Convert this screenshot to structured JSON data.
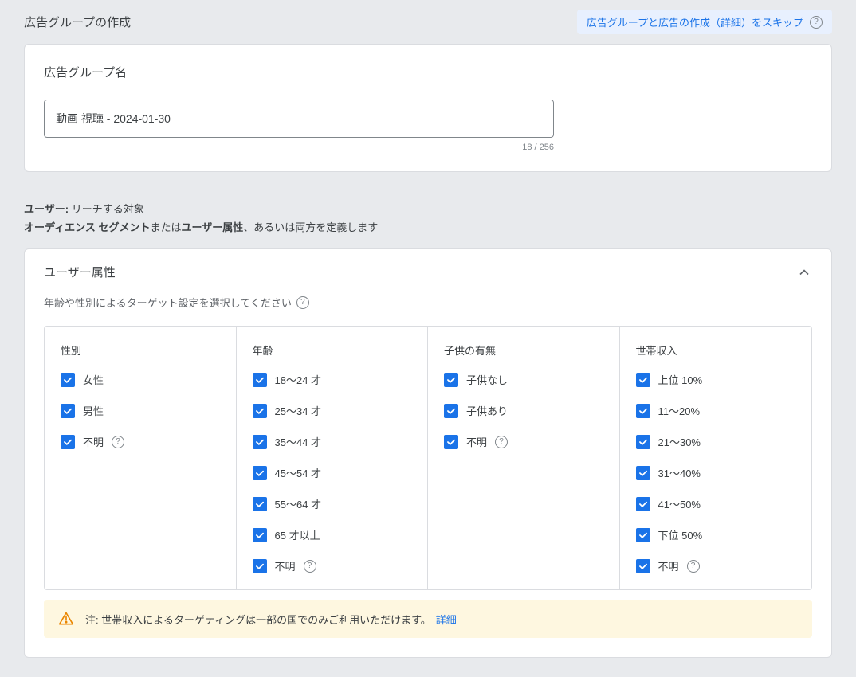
{
  "top": {
    "title": "広告グループの作成",
    "skip": "広告グループと広告の作成（詳細）をスキップ"
  },
  "adgroup": {
    "section_title": "広告グループ名",
    "name_value": "動画 視聴 - 2024-01-30",
    "char_count": "18 / 256"
  },
  "users": {
    "label": "ユーザー:",
    "reach": " リーチする対象",
    "seg1": "オーディエンス セグメント",
    "or": "または",
    "seg2": "ユーザー属性",
    "tail": "、あるいは両方を定義します"
  },
  "demo": {
    "panel_title": "ユーザー属性",
    "subtitle": "年齢や性別によるターゲット設定を選択してください",
    "columns": {
      "gender": {
        "title": "性別",
        "items": [
          "女性",
          "男性",
          "不明"
        ]
      },
      "age": {
        "title": "年齢",
        "items": [
          "18～24 才",
          "25～34 才",
          "35～44 才",
          "45～54 才",
          "55～64 才",
          "65 才以上",
          "不明"
        ]
      },
      "parental": {
        "title": "子供の有無",
        "items": [
          "子供なし",
          "子供あり",
          "不明"
        ]
      },
      "income": {
        "title": "世帯収入",
        "items": [
          "上位 10%",
          "11～20%",
          "21～30%",
          "31～40%",
          "41～50%",
          "下位 50%",
          "不明"
        ]
      }
    },
    "help_flags": {
      "gender": [
        false,
        false,
        true
      ],
      "age": [
        false,
        false,
        false,
        false,
        false,
        false,
        true
      ],
      "parental": [
        false,
        false,
        true
      ],
      "income": [
        false,
        false,
        false,
        false,
        false,
        false,
        true
      ]
    },
    "notice": {
      "prefix": "注: ",
      "text": "世帯収入によるターゲティングは一部の国でのみご利用いただけます。",
      "link": "詳細"
    }
  }
}
